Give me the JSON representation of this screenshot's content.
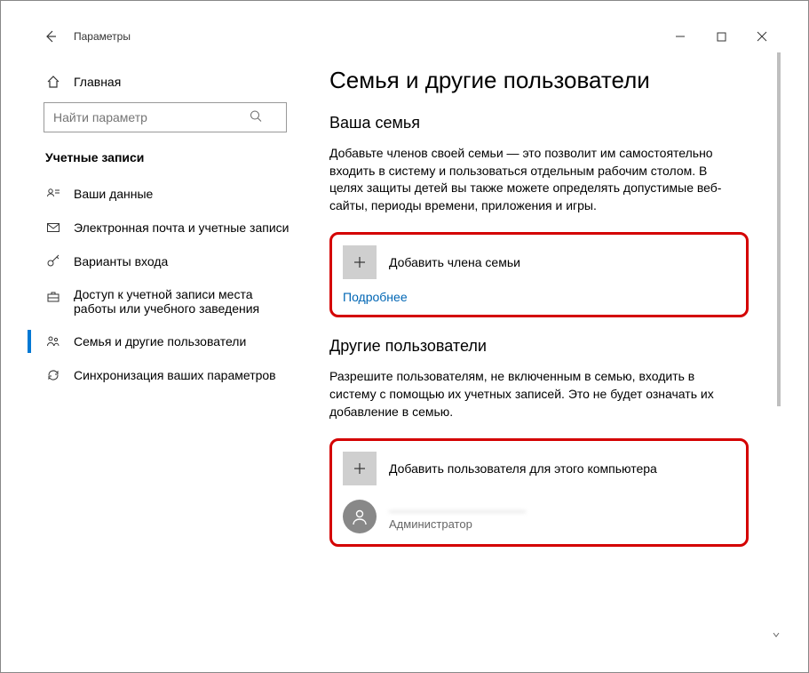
{
  "window": {
    "title": "Параметры"
  },
  "sidebar": {
    "home": "Главная",
    "search_placeholder": "Найти параметр",
    "section": "Учетные записи",
    "items": [
      {
        "label": "Ваши данные"
      },
      {
        "label": "Электронная почта и учетные записи"
      },
      {
        "label": "Варианты входа"
      },
      {
        "label": "Доступ к учетной записи места работы или учебного заведения"
      },
      {
        "label": "Семья и другие пользователи"
      },
      {
        "label": "Синхронизация ваших параметров"
      }
    ]
  },
  "main": {
    "title": "Семья и другие пользователи",
    "family_heading": "Ваша семья",
    "family_desc": "Добавьте членов своей семьи — это позволит им самостоятельно входить в систему и пользоваться отдельным рабочим столом. В целях защиты детей вы также можете определять допустимые веб-сайты, периоды времени, приложения и игры.",
    "add_family": "Добавить члена семьи",
    "more": "Подробнее",
    "others_heading": "Другие пользователи",
    "others_desc": "Разрешите пользователям, не включенным в семью, входить в систему с помощью их учетных записей. Это не будет означать их добавление в семью.",
    "add_other": "Добавить пользователя для этого компьютера",
    "user_name": "———————————",
    "user_role": "Администратор"
  }
}
